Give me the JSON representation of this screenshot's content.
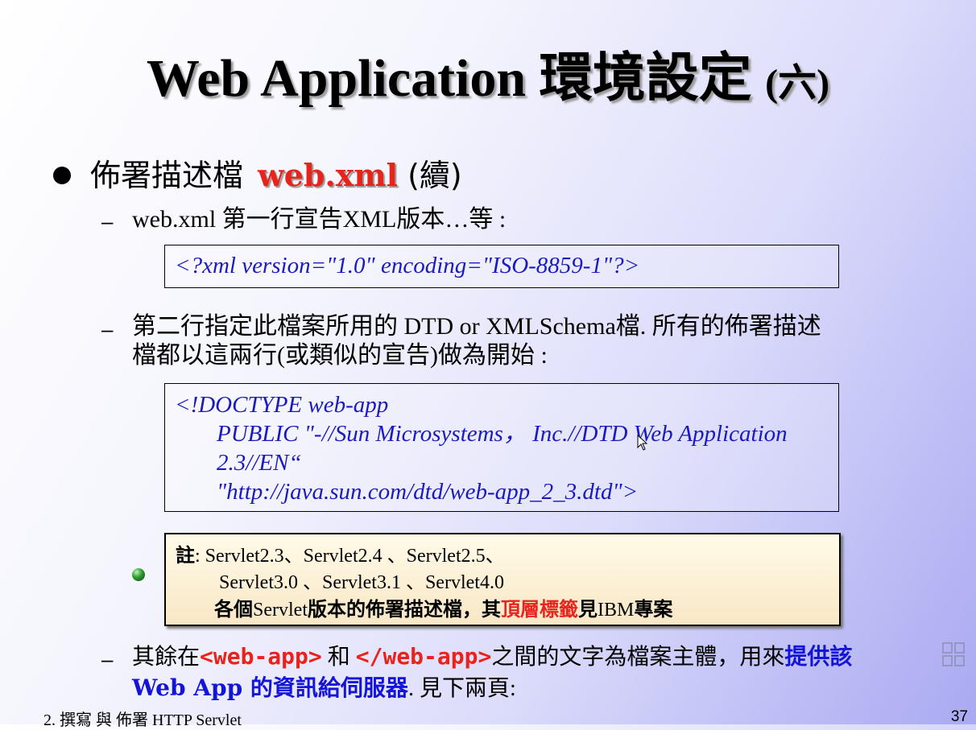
{
  "slide": {
    "title_main": "Web Application 環境設定 ",
    "title_paren": "(六)",
    "bullet": {
      "text": "佈署描述檔",
      "highlight": "web.xml",
      "suffix": " (續)"
    },
    "item1": {
      "dash": "–",
      "text": "web.xml 第一行宣告XML版本…等 :"
    },
    "code1": "<?xml version=\"1.0\" encoding=\"ISO-8859-1\"?>",
    "item2": {
      "dash": "–",
      "line1": "第二行指定此檔案所用的 DTD or XMLSchema檔. 所有的佈署描述",
      "line2": "檔都以這兩行(或類似的宣告)做為開始 :"
    },
    "code2": {
      "line1": "<!DOCTYPE web-app",
      "line2": "PUBLIC \"-//Sun Microsystems， Inc.//DTD Web Application",
      "line3": "2.3//EN“",
      "line4": "\"http://java.sun.com/dtd/web-app_2_3.dtd\">"
    },
    "note": {
      "label": "註",
      "line1": ": Servlet2.3、Servlet2.4 、Servlet2.5、",
      "line2": "Servlet3.0 、Servlet3.1 、Servlet4.0",
      "line3_a": "各個",
      "line3_b": "Servlet",
      "line3_c": "版本的佈署描述檔，其",
      "line3_red": "頂層標籤",
      "line3_d": "見",
      "line3_e": "IBM",
      "line3_f": "專案"
    },
    "item3": {
      "dash": "–",
      "t1": "其餘在",
      "tag_open": "<web-app>",
      "t2": " 和 ",
      "tag_close": "</web-app>",
      "t3": "之間的文字為檔案主體，用來",
      "blue1": "提供該",
      "blue2_a": "Web App",
      "blue2_b": " 的資訊給伺服器",
      "t4": ". 見下兩頁:"
    },
    "footer_left": "2. 撰寫 與 佈署 HTTP Servlet",
    "page_number": "37"
  },
  "colors": {
    "accent_red": "#e8231c",
    "code_blue": "#1a1abf",
    "bold_blue": "#1414d9"
  },
  "icons": {
    "bullet": "filled-circle-icon",
    "sub_bullet": "green-sphere-icon",
    "cursor": "mouse-cursor-icon",
    "side": "presentation-control-icon"
  }
}
